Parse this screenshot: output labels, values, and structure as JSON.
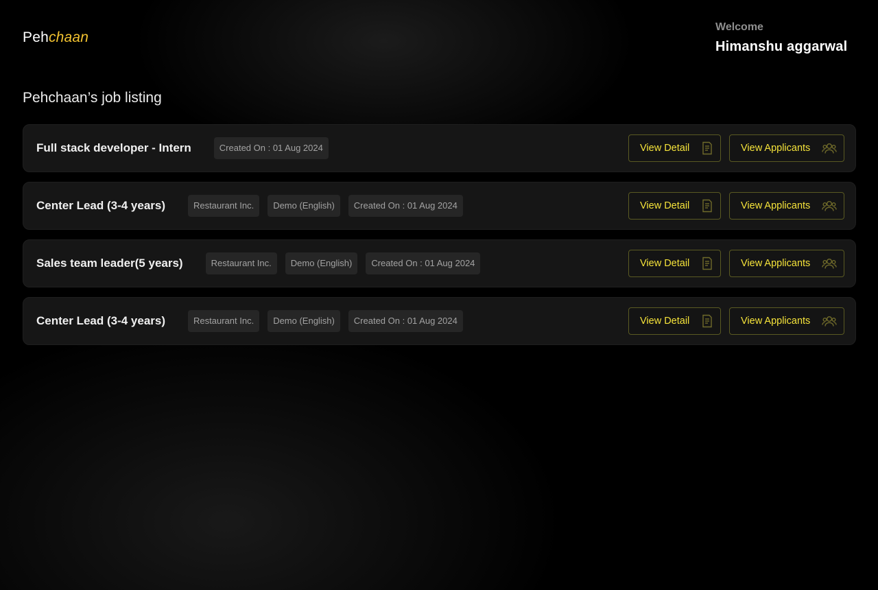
{
  "brand": {
    "prefix": "Peh",
    "accent": "chaan"
  },
  "user": {
    "greeting": "Welcome",
    "name": "Himanshu aggarwal"
  },
  "page": {
    "heading": "Pehchaan’s job listing"
  },
  "colors": {
    "accent": "#f5e33a",
    "brand_accent": "#f2c230"
  },
  "jobs": [
    {
      "title": "Full stack developer - Intern",
      "tags": [
        "Created On : 01 Aug 2024"
      ],
      "view_detail": "View Detail",
      "view_applicants": "View Applicants"
    },
    {
      "title": "Center Lead (3-4 years)",
      "tags": [
        "Restaurant Inc.",
        "Demo (English)",
        "Created On : 01 Aug 2024"
      ],
      "view_detail": "View Detail",
      "view_applicants": "View Applicants"
    },
    {
      "title": "Sales team leader(5 years)",
      "tags": [
        "Restaurant Inc.",
        "Demo (English)",
        "Created On : 01 Aug 2024"
      ],
      "view_detail": "View Detail",
      "view_applicants": "View Applicants"
    },
    {
      "title": "Center Lead (3-4 years)",
      "tags": [
        "Restaurant Inc.",
        "Demo (English)",
        "Created On : 01 Aug 2024"
      ],
      "view_detail": "View Detail",
      "view_applicants": "View Applicants"
    }
  ],
  "icons": {
    "detail": "document-icon",
    "applicants": "users-icon"
  }
}
